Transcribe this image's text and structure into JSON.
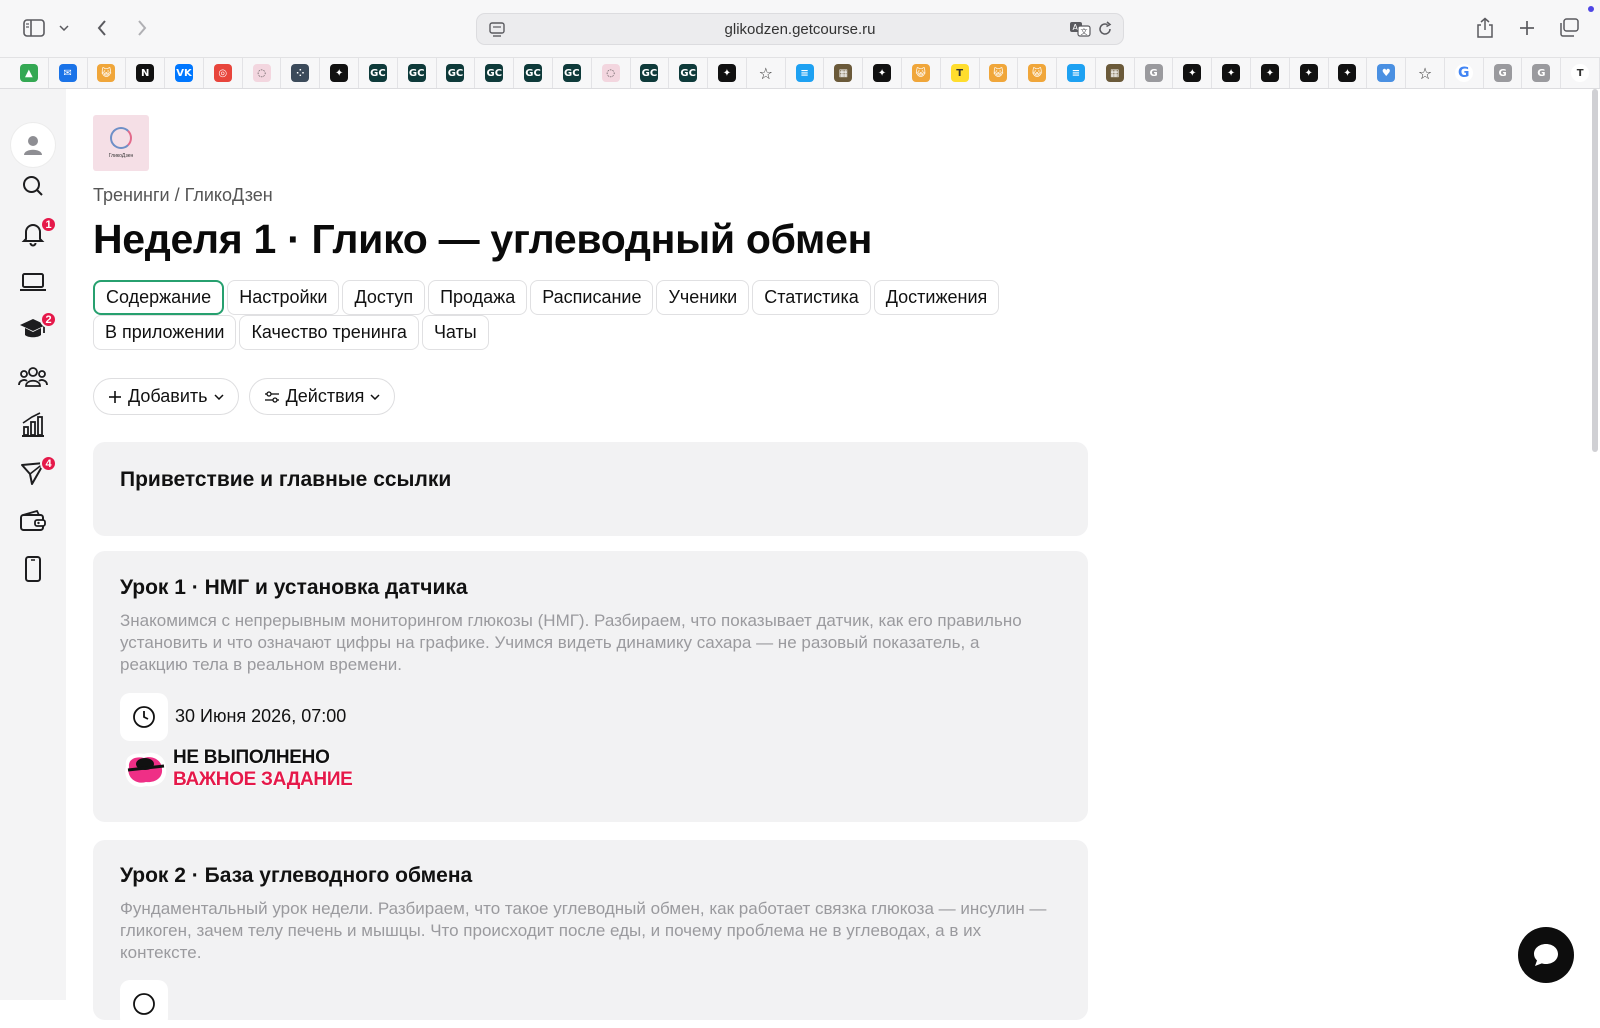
{
  "browser": {
    "url": "glikodzen.getcourse.ru",
    "bookmarks": [
      {
        "icon": "google-drive-icon",
        "color": "#34a853",
        "glyph": "▲"
      },
      {
        "icon": "mail-icon",
        "color": "#1a73e8",
        "glyph": "✉"
      },
      {
        "icon": "cat-icon",
        "color": "#f0a63a",
        "glyph": "😺"
      },
      {
        "icon": "notion-icon",
        "color": "#111111",
        "glyph": "N"
      },
      {
        "icon": "vk-icon",
        "color": "#0077ff",
        "glyph": "VK"
      },
      {
        "icon": "target-icon",
        "color": "#e8453c",
        "glyph": "◎"
      },
      {
        "icon": "glikodzen-icon",
        "color": "#f3d6df",
        "glyph": "◌"
      },
      {
        "icon": "dots-icon",
        "color": "#3b4a5a",
        "glyph": "⁘"
      },
      {
        "icon": "sparkle-icon",
        "color": "#111111",
        "glyph": "✦"
      },
      {
        "icon": "getcourse-icon",
        "color": "#0e3a3a",
        "glyph": "GC"
      },
      {
        "icon": "getcourse-icon",
        "color": "#0e3a3a",
        "glyph": "GC"
      },
      {
        "icon": "getcourse-icon",
        "color": "#0e3a3a",
        "glyph": "GC"
      },
      {
        "icon": "getcourse-icon",
        "color": "#0e3a3a",
        "glyph": "GC"
      },
      {
        "icon": "getcourse-icon",
        "color": "#0e3a3a",
        "glyph": "GC"
      },
      {
        "icon": "getcourse-icon",
        "color": "#0e3a3a",
        "glyph": "GC"
      },
      {
        "icon": "glikodzen-icon",
        "color": "#f3d6df",
        "glyph": "◌"
      },
      {
        "icon": "getcourse-icon",
        "color": "#0e3a3a",
        "glyph": "GC"
      },
      {
        "icon": "getcourse-icon",
        "color": "#0e3a3a",
        "glyph": "GC"
      },
      {
        "icon": "sparkle-icon",
        "color": "#111111",
        "glyph": "✦"
      },
      {
        "icon": "star-icon",
        "color": "#f7f7f8",
        "glyph": "☆"
      },
      {
        "icon": "list-icon",
        "color": "#1ea1f2",
        "glyph": "≡"
      },
      {
        "icon": "photo-icon",
        "color": "#6b5a3a",
        "glyph": "▦"
      },
      {
        "icon": "sparkle-icon",
        "color": "#111111",
        "glyph": "✦"
      },
      {
        "icon": "cat-icon",
        "color": "#f0a63a",
        "glyph": "😺"
      },
      {
        "icon": "t-icon",
        "color": "#ffdd2d",
        "glyph": "T"
      },
      {
        "icon": "cat-icon",
        "color": "#f0a63a",
        "glyph": "😺"
      },
      {
        "icon": "cat-icon",
        "color": "#f0a63a",
        "glyph": "😺"
      },
      {
        "icon": "list-icon",
        "color": "#1ea1f2",
        "glyph": "≡"
      },
      {
        "icon": "photo-icon",
        "color": "#6b5a3a",
        "glyph": "▦"
      },
      {
        "icon": "g-icon",
        "color": "#9a9a9e",
        "glyph": "G"
      },
      {
        "icon": "sparkle-icon",
        "color": "#111111",
        "glyph": "✦"
      },
      {
        "icon": "sparkle-icon",
        "color": "#111111",
        "glyph": "✦"
      },
      {
        "icon": "sparkle-icon",
        "color": "#111111",
        "glyph": "✦"
      },
      {
        "icon": "sparkle-icon",
        "color": "#111111",
        "glyph": "✦"
      },
      {
        "icon": "sparkle-icon",
        "color": "#111111",
        "glyph": "✦"
      },
      {
        "icon": "heart-icon",
        "color": "#4a90e2",
        "glyph": "♥"
      },
      {
        "icon": "star-icon",
        "color": "#f7f7f8",
        "glyph": "☆"
      },
      {
        "icon": "google-icon",
        "color": "#ffffff",
        "glyph": "G"
      },
      {
        "icon": "g-icon",
        "color": "#9a9a9e",
        "glyph": "G"
      },
      {
        "icon": "g-icon",
        "color": "#9a9a9e",
        "glyph": "G"
      },
      {
        "icon": "t-circle-icon",
        "color": "#ffffff",
        "glyph": "T"
      }
    ]
  },
  "sidebar": {
    "items": [
      {
        "icon": "search-icon",
        "badge": ""
      },
      {
        "icon": "bell-icon",
        "badge": "1"
      },
      {
        "icon": "laptop-icon",
        "badge": ""
      },
      {
        "icon": "graduation-cap-icon",
        "badge": "2"
      },
      {
        "icon": "users-icon",
        "badge": ""
      },
      {
        "icon": "chart-icon",
        "badge": ""
      },
      {
        "icon": "send-icon",
        "badge": "4"
      },
      {
        "icon": "wallet-icon",
        "badge": ""
      },
      {
        "icon": "phone-icon",
        "badge": ""
      }
    ]
  },
  "page": {
    "logo_text": "ГликоДзен",
    "breadcrumb": {
      "root": "Тренинги",
      "separator": " / ",
      "current": "ГликоДзен"
    },
    "title": "Неделя 1 · Глико — углеводный обмен",
    "tabs_row1": [
      "Содержание",
      "Настройки",
      "Доступ",
      "Продажа",
      "Расписание",
      "Ученики",
      "Статистика",
      "Достижения"
    ],
    "tabs_row2": [
      "В приложении",
      "Качество тренинга",
      "Чаты"
    ],
    "actions": {
      "add": "Добавить",
      "actions": "Действия"
    }
  },
  "lessons": [
    {
      "title": "Приветствие и главные ссылки"
    },
    {
      "title": "Урок 1 · НМГ и установка датчика",
      "description": "Знакомимся с непрерывным мониторингом глюкозы (НМГ). Разбираем, что показывает датчик, как его правильно установить и что означают цифры на графике. Учимся видеть динамику сахара — не разовый показатель, а реакцию тела в реальном времени.",
      "date": "30 Июня 2026, 07:00",
      "status": "НЕ ВЫПОЛНЕНО",
      "priority": "ВАЖНОЕ ЗАДАНИЕ"
    },
    {
      "title": "Урок 2 · База углеводного обмена",
      "description": "Фундаментальный урок недели. Разбираем, что такое углеводный обмен, как работает связка глюкоза — инсулин — гликоген, зачем телу печень и мышцы. Что происходит после еды, и почему проблема не в углеводах, а в их контексте."
    }
  ],
  "colors": {
    "accent": "#27a06f",
    "badge": "#e5194a",
    "priority": "#e5194a"
  }
}
